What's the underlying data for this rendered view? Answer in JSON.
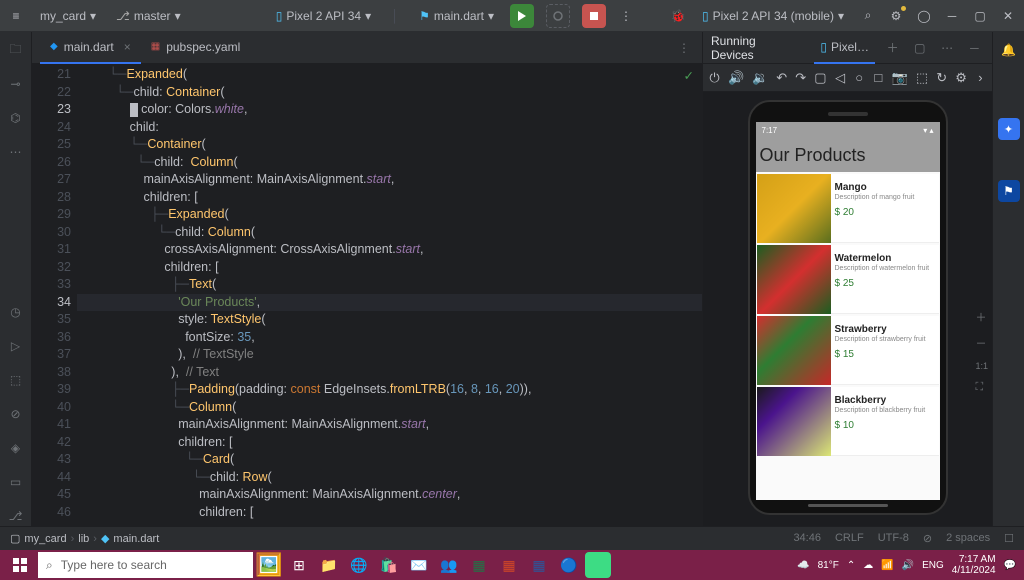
{
  "topbar": {
    "project": "my_card",
    "branch": "master",
    "emulator": "Pixel 2 API 34",
    "run_config": "main.dart",
    "device": "Pixel 2 API 34 (mobile)"
  },
  "tabs": {
    "main": "main.dart",
    "pubspec": "pubspec.yaml"
  },
  "code": {
    "lines": [
      {
        "n": 21,
        "pre": "        ",
        "tree": "└─",
        "text": [
          {
            "c": "c-type",
            "t": "Expanded"
          },
          {
            "c": "",
            "t": "("
          }
        ]
      },
      {
        "n": 22,
        "pre": "          ",
        "tree": "└─",
        "text": [
          {
            "c": "",
            "t": "child: "
          },
          {
            "c": "c-type",
            "t": "Container"
          },
          {
            "c": "",
            "t": "("
          }
        ]
      },
      {
        "n": 23,
        "pre": "              ",
        "tree": "",
        "cursor": true,
        "text": [
          {
            "c": "",
            "t": "color: Colors."
          },
          {
            "c": "c-static",
            "t": "white"
          },
          {
            "c": "",
            "t": ","
          }
        ]
      },
      {
        "n": 24,
        "pre": "              ",
        "tree": "",
        "text": [
          {
            "c": "",
            "t": "child:"
          }
        ]
      },
      {
        "n": 25,
        "pre": "              ",
        "tree": "└─",
        "text": [
          {
            "c": "c-type",
            "t": "Container"
          },
          {
            "c": "",
            "t": "("
          }
        ]
      },
      {
        "n": 26,
        "pre": "                ",
        "tree": "└─",
        "text": [
          {
            "c": "",
            "t": "child:  "
          },
          {
            "c": "c-type",
            "t": "Column"
          },
          {
            "c": "",
            "t": "("
          }
        ]
      },
      {
        "n": 27,
        "pre": "                  ",
        "tree": "",
        "text": [
          {
            "c": "",
            "t": "mainAxisAlignment: MainAxisAlignment."
          },
          {
            "c": "c-static",
            "t": "start"
          },
          {
            "c": "",
            "t": ","
          }
        ]
      },
      {
        "n": 28,
        "pre": "                  ",
        "tree": "",
        "text": [
          {
            "c": "",
            "t": "children: ["
          }
        ]
      },
      {
        "n": 29,
        "pre": "                    ",
        "tree": "├─",
        "text": [
          {
            "c": "c-type",
            "t": "Expanded"
          },
          {
            "c": "",
            "t": "("
          }
        ]
      },
      {
        "n": 30,
        "pre": "                      ",
        "tree": "└─",
        "text": [
          {
            "c": "",
            "t": "child: "
          },
          {
            "c": "c-type",
            "t": "Column"
          },
          {
            "c": "",
            "t": "("
          }
        ]
      },
      {
        "n": 31,
        "pre": "                        ",
        "tree": "",
        "text": [
          {
            "c": "",
            "t": "crossAxisAlignment: CrossAxisAlignment."
          },
          {
            "c": "c-static",
            "t": "start"
          },
          {
            "c": "",
            "t": ","
          }
        ]
      },
      {
        "n": 32,
        "pre": "                        ",
        "tree": "",
        "text": [
          {
            "c": "",
            "t": "children: ["
          }
        ]
      },
      {
        "n": 33,
        "pre": "                          ",
        "tree": "├─",
        "text": [
          {
            "c": "c-type",
            "t": "Text"
          },
          {
            "c": "",
            "t": "("
          }
        ]
      },
      {
        "n": 34,
        "pre": "                            ",
        "tree": "",
        "hl": true,
        "text": [
          {
            "c": "c-str",
            "t": "'Our Products'"
          },
          {
            "c": "",
            "t": ","
          }
        ]
      },
      {
        "n": 35,
        "pre": "                            ",
        "tree": "",
        "text": [
          {
            "c": "",
            "t": "style: "
          },
          {
            "c": "c-type",
            "t": "TextStyle"
          },
          {
            "c": "",
            "t": "("
          }
        ]
      },
      {
        "n": 36,
        "pre": "                              ",
        "tree": "",
        "text": [
          {
            "c": "",
            "t": "fontSize: "
          },
          {
            "c": "c-num",
            "t": "35"
          },
          {
            "c": "",
            "t": ","
          }
        ]
      },
      {
        "n": 37,
        "pre": "                            ",
        "tree": "",
        "text": [
          {
            "c": "",
            "t": "),  "
          },
          {
            "c": "c-comment",
            "t": "// TextStyle"
          }
        ]
      },
      {
        "n": 38,
        "pre": "                          ",
        "tree": "",
        "text": [
          {
            "c": "",
            "t": "),  "
          },
          {
            "c": "c-comment",
            "t": "// Text"
          }
        ]
      },
      {
        "n": 39,
        "pre": "                          ",
        "tree": "├─",
        "text": [
          {
            "c": "c-type",
            "t": "Padding"
          },
          {
            "c": "",
            "t": "(padding: "
          },
          {
            "c": "c-kw",
            "t": "const"
          },
          {
            "c": "",
            "t": " EdgeInsets."
          },
          {
            "c": "c-method",
            "t": "fromLTRB"
          },
          {
            "c": "",
            "t": "("
          },
          {
            "c": "c-num",
            "t": "16"
          },
          {
            "c": "",
            "t": ", "
          },
          {
            "c": "c-num",
            "t": "8"
          },
          {
            "c": "",
            "t": ", "
          },
          {
            "c": "c-num",
            "t": "16"
          },
          {
            "c": "",
            "t": ", "
          },
          {
            "c": "c-num",
            "t": "20"
          },
          {
            "c": "",
            "t": ")),"
          }
        ]
      },
      {
        "n": 40,
        "pre": "                          ",
        "tree": "└─",
        "text": [
          {
            "c": "c-type",
            "t": "Column"
          },
          {
            "c": "",
            "t": "("
          }
        ]
      },
      {
        "n": 41,
        "pre": "                            ",
        "tree": "",
        "text": [
          {
            "c": "",
            "t": "mainAxisAlignment: MainAxisAlignment."
          },
          {
            "c": "c-static",
            "t": "start"
          },
          {
            "c": "",
            "t": ","
          }
        ]
      },
      {
        "n": 42,
        "pre": "                            ",
        "tree": "",
        "text": [
          {
            "c": "",
            "t": "children: ["
          }
        ]
      },
      {
        "n": 43,
        "pre": "                              ",
        "tree": "└─",
        "text": [
          {
            "c": "c-type",
            "t": "Card"
          },
          {
            "c": "",
            "t": "("
          }
        ]
      },
      {
        "n": 44,
        "pre": "                                ",
        "tree": "└─",
        "text": [
          {
            "c": "",
            "t": "child: "
          },
          {
            "c": "c-type",
            "t": "Row"
          },
          {
            "c": "",
            "t": "("
          }
        ]
      },
      {
        "n": 45,
        "pre": "                                  ",
        "tree": "",
        "text": [
          {
            "c": "",
            "t": "mainAxisAlignment: MainAxisAlignment."
          },
          {
            "c": "c-static",
            "t": "center"
          },
          {
            "c": "",
            "t": ","
          }
        ]
      },
      {
        "n": 46,
        "pre": "                                  ",
        "tree": "",
        "text": [
          {
            "c": "",
            "t": "children: ["
          }
        ]
      }
    ]
  },
  "running_panel": {
    "title": "Running Devices",
    "tab": "Pixel…"
  },
  "phone": {
    "time": "7:17",
    "header": "Our Products",
    "products": [
      {
        "name": "Mango",
        "desc": "Description of mango fruit",
        "price": "$ 20",
        "img": "img-mango"
      },
      {
        "name": "Watermelon",
        "desc": "Description of watermelon fruit",
        "price": "$ 25",
        "img": "img-watermelon"
      },
      {
        "name": "Strawberry",
        "desc": "Description of strawberry fruit",
        "price": "$ 15",
        "img": "img-strawberry"
      },
      {
        "name": "Blackberry",
        "desc": "Description of blackberry fruit",
        "price": "$ 10",
        "img": "img-blackberry"
      }
    ]
  },
  "zoom": {
    "ratio": "1:1"
  },
  "statusbar": {
    "bc1": "my_card",
    "bc2": "lib",
    "bc3": "main.dart",
    "pos": "34:46",
    "crlf": "CRLF",
    "enc": "UTF-8",
    "lock": "🔒",
    "indent": "2 spaces"
  },
  "taskbar": {
    "search_ph": "Type here to search",
    "temp": "81°F",
    "lang": "ENG",
    "time": "7:17 AM",
    "date": "4/11/2024"
  }
}
